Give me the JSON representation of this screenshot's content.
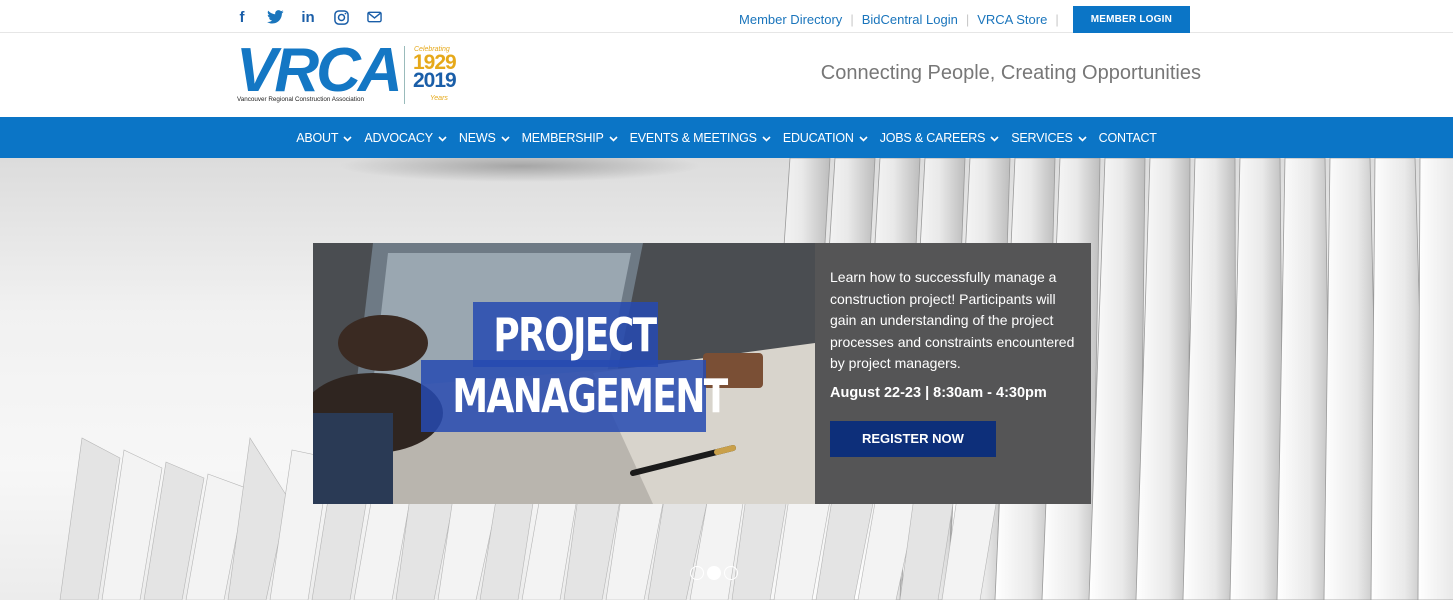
{
  "social": {
    "icons": [
      "facebook-icon",
      "twitter-icon",
      "linkedin-icon",
      "instagram-icon",
      "email-icon"
    ],
    "facebook_glyph": "f",
    "linkedin_glyph": "in"
  },
  "utility": {
    "links": [
      "Member Directory",
      "BidCentral Login",
      "VRCA Store"
    ],
    "login_button": "MEMBER LOGIN"
  },
  "logo": {
    "wordmark": "VRCA",
    "subtitle": "Vancouver Regional Construction Association",
    "celebrating": "Celebrating",
    "year_start": "1929",
    "year_end": "2019",
    "years": "Years"
  },
  "tagline": "Connecting People, Creating Opportunities",
  "nav": {
    "items": [
      {
        "label": "ABOUT",
        "dropdown": true
      },
      {
        "label": "ADVOCACY",
        "dropdown": true
      },
      {
        "label": "NEWS",
        "dropdown": true
      },
      {
        "label": "MEMBERSHIP",
        "dropdown": true
      },
      {
        "label": "EVENTS & MEETINGS",
        "dropdown": true
      },
      {
        "label": "EDUCATION",
        "dropdown": true
      },
      {
        "label": "JOBS & CAREERS",
        "dropdown": true
      },
      {
        "label": "SERVICES",
        "dropdown": true
      },
      {
        "label": "CONTACT",
        "dropdown": false
      }
    ]
  },
  "slide": {
    "image_title_line1": "PROJECT",
    "image_title_line2": "MANAGEMENT",
    "description": "Learn how to successfully manage a construction project! Participants will gain an understanding of the project processes and constraints encountered by project managers.",
    "date": "August 22-23 | 8:30am - 4:30pm",
    "cta": "REGISTER NOW"
  },
  "carousel": {
    "count": 3,
    "active_index": 1
  },
  "colors": {
    "brand_blue": "#0b75c6",
    "cta_navy": "#0d2f7a",
    "gold": "#e6a91a"
  }
}
